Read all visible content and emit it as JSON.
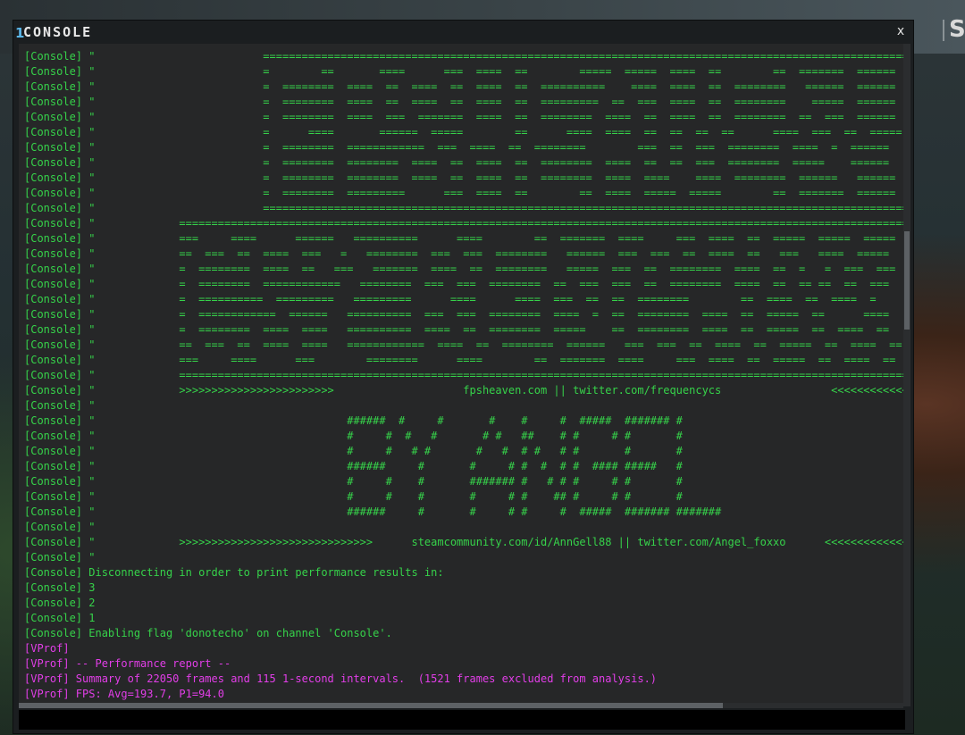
{
  "window": {
    "title_accent": "1",
    "title": "CONSOLE",
    "close_label": "x"
  },
  "background": {
    "corner_glyph": "S"
  },
  "input": {
    "value": "",
    "placeholder": ""
  },
  "colors": {
    "console_text": "#36d24a",
    "vprof_text": "#e23ee8",
    "window_bg": "#1b1e20",
    "log_bg": "#262728",
    "title_accent": "#5bb7ea"
  },
  "log_lines": [
    {
      "color": "green",
      "text": "[Console] \"                          ==========================================================================================================="
    },
    {
      "color": "green",
      "text": "[Console] \"                          =        ==       ====      ===  ====  ==        =====  =====  ====  ==        ==  =======  ======"
    },
    {
      "color": "green",
      "text": "[Console] \"                          =  ========  ====  ==  ====  ==  ====  ==  ==========    ====  ====  ==  ========   ======  ======"
    },
    {
      "color": "green",
      "text": "[Console] \"                          =  ========  ====  ==  ====  ==  ====  ==  =========  ==  ===  ====  ==  ========    =====  ======"
    },
    {
      "color": "green",
      "text": "[Console] \"                          =  ========  ====  ===  =======  ====  ==  ========  ====  ==  ====  ==  ========  ==  ===  ======"
    },
    {
      "color": "green",
      "text": "[Console] \"                          =      ====       ======  =====        ==      ====  ====  ==  ==  ==  ==      ====  ===  ==  ====="
    },
    {
      "color": "green",
      "text": "[Console] \"                          =  ========  ============  ===  ====  ==  ========        ===  ==  ===  ========  ====  =  ======"
    },
    {
      "color": "green",
      "text": "[Console] \"                          =  ========  ========  ====  ==  ====  ==  ========  ====  ==  ==  ===  ========  =====    ======"
    },
    {
      "color": "green",
      "text": "[Console] \"                          =  ========  ========  ====  ==  ====  ==  ========  ====  ====    ====  ========  ======   ======"
    },
    {
      "color": "green",
      "text": "[Console] \"                          =  ========  =========      ===  ====  ==        ==  ====  =====  =====        ==  =======  ======"
    },
    {
      "color": "green",
      "text": "[Console] \"                          ==========================================================================================================="
    },
    {
      "color": "green",
      "text": "[Console] \"             ===================================================================================================================="
    },
    {
      "color": "green",
      "text": "[Console] \"             ===     ====      ======   ==========      ====        ==  =======  ====     ===  ====  ==  =====  =====  ====="
    },
    {
      "color": "green",
      "text": "[Console] \"             ==  ===  ==  ====  ===   =   ========  ===  ===  ========   ======  ===  ===  ==  ====  ==   ===   ====  ====="
    },
    {
      "color": "green",
      "text": "[Console] \"             =  ========  ====  ==   ===   =======  ====  ==  ========   =====  ===  ==  ========  ====  ==  =   =  ===  ==="
    },
    {
      "color": "green",
      "text": "[Console] \"             =  ========  ============   ========  ===  ===  ========  ==  ===  ===  ==  ========  ====  ==  == ==  ==  ==="
    },
    {
      "color": "green",
      "text": "[Console] \"             =  ==========  =========   =========      ====      ====  ===  ==  ==  ========        ==  ====  ==  ====  ="
    },
    {
      "color": "green",
      "text": "[Console] \"             =  ============  ======   ==========  ===  ===  ========  ====  =  ==  ========  ====  ==  =====  ==      ===="
    },
    {
      "color": "green",
      "text": "[Console] \"             =  ========  ====  ====   ==========  ====  ==  ========  =====    ==  ========  ====  ==  =====  ==  ====  =="
    },
    {
      "color": "green",
      "text": "[Console] \"             ==  ===  ==  ====  ====   ============  ====  ==  ========  ======   ===  ===  ==  ====  ==  =====  ==  ====  =="
    },
    {
      "color": "green",
      "text": "[Console] \"             ===     ====      ===        ========      ====        ==  =======  ====     ===  ====  ==  =====  ==  ====  =="
    },
    {
      "color": "green",
      "text": "[Console] \"             ===================================================================================================================="
    },
    {
      "color": "green",
      "text": "[Console] \"             >>>>>>>>>>>>>>>>>>>>>>>>                    fpsheaven.com || twitter.com/frequencycs                 <<<<<<<<<<<<<<<<<<"
    },
    {
      "color": "green",
      "text": "[Console] \""
    },
    {
      "color": "green",
      "text": "[Console] \"                                       ######  #     #       #    #     #  #####  ####### #"
    },
    {
      "color": "green",
      "text": "[Console] \"                                       #     #  #   #       # #   ##    # #     # #       #"
    },
    {
      "color": "green",
      "text": "[Console] \"                                       #     #   # #       #   #  # #   # #       #       #"
    },
    {
      "color": "green",
      "text": "[Console] \"                                       ######     #       #     # #  #  # #  #### #####   #"
    },
    {
      "color": "green",
      "text": "[Console] \"                                       #     #    #       ####### #   # # #     # #       #"
    },
    {
      "color": "green",
      "text": "[Console] \"                                       #     #    #       #     # #    ## #     # #       #"
    },
    {
      "color": "green",
      "text": "[Console] \"                                       ######     #       #     # #     #  #####  ####### #######"
    },
    {
      "color": "green",
      "text": "[Console] \""
    },
    {
      "color": "green",
      "text": "[Console] \"             >>>>>>>>>>>>>>>>>>>>>>>>>>>>>>      steamcommunity.com/id/AnnGell88 || twitter.com/Angel_foxxo      <<<<<<<<<<<<<<<<<<"
    },
    {
      "color": "green",
      "text": "[Console] \""
    },
    {
      "color": "green",
      "text": "[Console] Disconnecting in order to print performance results in:"
    },
    {
      "color": "green",
      "text": "[Console] 3"
    },
    {
      "color": "green",
      "text": "[Console] 2"
    },
    {
      "color": "green",
      "text": "[Console] 1"
    },
    {
      "color": "green",
      "text": "[Console] Enabling flag 'donotecho' on channel 'Console'."
    },
    {
      "color": "magenta",
      "text": "[VProf]"
    },
    {
      "color": "magenta",
      "text": "[VProf] -- Performance report --"
    },
    {
      "color": "magenta",
      "text": "[VProf] Summary of 22050 frames and 115 1-second intervals.  (1521 frames excluded from analysis.)"
    },
    {
      "color": "magenta",
      "text": "[VProf] FPS: Avg=193.7, P1=94.0"
    }
  ]
}
